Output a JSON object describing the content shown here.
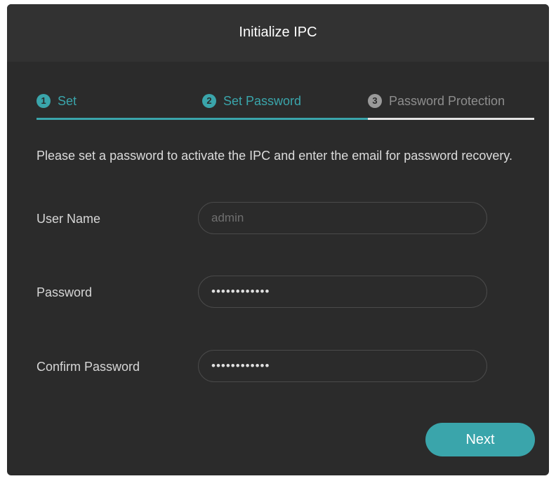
{
  "dialog": {
    "title": "Initialize IPC"
  },
  "steps": [
    {
      "number": "1",
      "label": "Set",
      "state": "active"
    },
    {
      "number": "2",
      "label": "Set Password",
      "state": "active"
    },
    {
      "number": "3",
      "label": "Password Protection",
      "state": "inactive"
    }
  ],
  "instructions": "Please set a password to activate the IPC and enter the email for password recovery.",
  "form": {
    "username": {
      "label": "User Name",
      "value": "admin"
    },
    "password": {
      "label": "Password",
      "value": "••••••••••••"
    },
    "confirm_password": {
      "label": "Confirm Password",
      "value": "••••••••••••"
    }
  },
  "actions": {
    "next_label": "Next"
  },
  "colors": {
    "accent": "#3aa5ab",
    "background": "#2b2b2b",
    "header": "#323232",
    "inactive_step": "#9a9a9a"
  }
}
